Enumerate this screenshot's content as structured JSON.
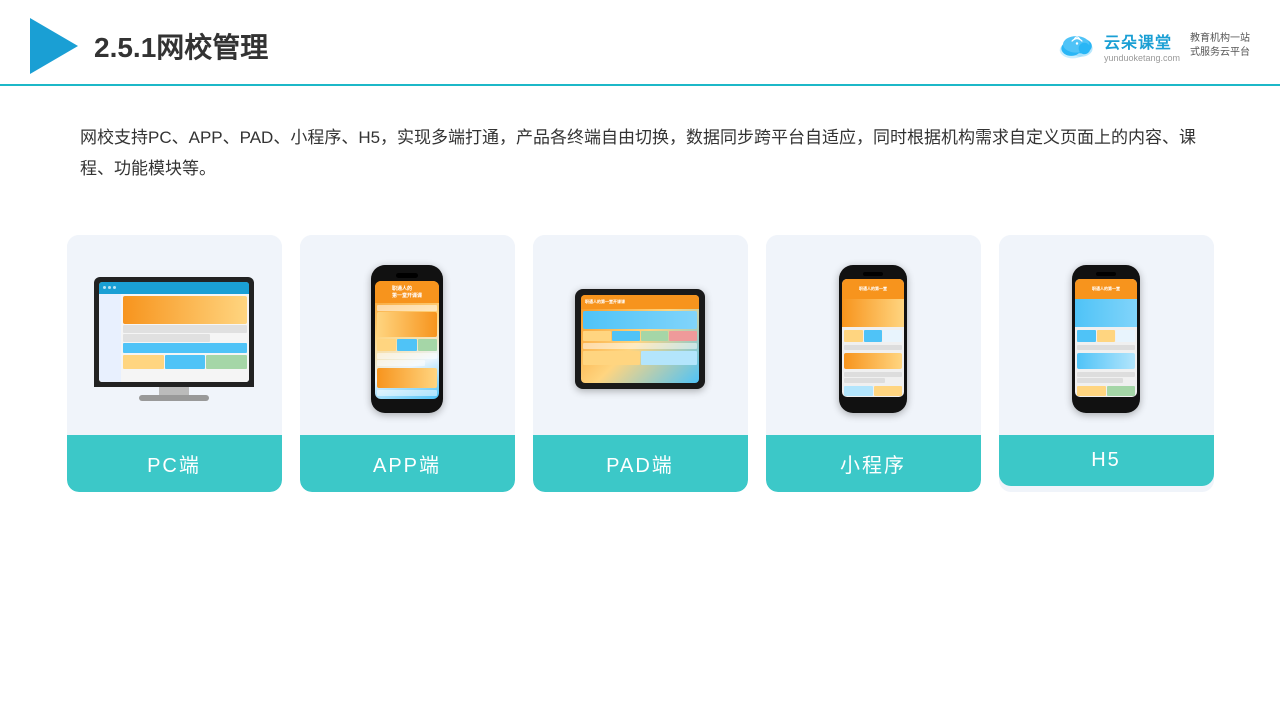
{
  "header": {
    "title": "2.5.1网校管理",
    "brand": {
      "name": "云朵课堂",
      "url": "yunduoketang.com",
      "tagline": "教育机构一站\n式服务云平台"
    }
  },
  "description": "网校支持PC、APP、PAD、小程序、H5，实现多端打通，产品各终端自由切换，数据同步跨平台自适应，同时根据机构需求自定义页面上的内容、课程、功能模块等。",
  "cards": [
    {
      "id": "pc",
      "label": "PC端",
      "device": "pc"
    },
    {
      "id": "app",
      "label": "APP端",
      "device": "phone"
    },
    {
      "id": "pad",
      "label": "PAD端",
      "device": "tablet"
    },
    {
      "id": "miniapp",
      "label": "小程序",
      "device": "miniphone"
    },
    {
      "id": "h5",
      "label": "H5",
      "device": "miniphone2"
    }
  ],
  "colors": {
    "accent": "#1cb8c8",
    "teal": "#3cc8c8",
    "blue": "#1a9fd4"
  }
}
